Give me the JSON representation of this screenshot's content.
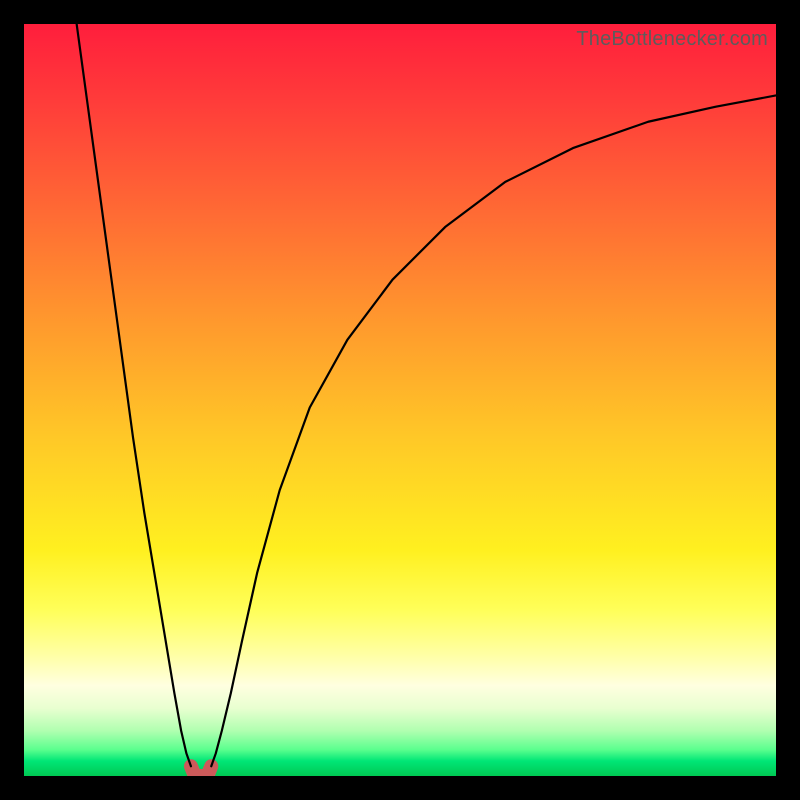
{
  "watermark": {
    "text": "TheBottlenecker.com"
  },
  "chart_data": {
    "type": "line",
    "title": "",
    "xlabel": "",
    "ylabel": "",
    "xlim": [
      0,
      100
    ],
    "ylim": [
      0,
      100
    ],
    "grid": false,
    "legend": false,
    "series": [
      {
        "name": "curve-left",
        "x": [
          7.0,
          8.5,
          10.0,
          11.5,
          13.0,
          14.5,
          16.0,
          17.5,
          19.0,
          20.0,
          20.9,
          21.6,
          22.2
        ],
        "y": [
          100,
          89,
          78,
          67,
          56,
          45,
          35,
          26,
          17,
          11,
          6,
          3,
          1.3
        ]
      },
      {
        "name": "curve-right",
        "x": [
          24.9,
          25.5,
          26.3,
          27.5,
          29.0,
          31.0,
          34.0,
          38.0,
          43.0,
          49.0,
          56.0,
          64.0,
          73.0,
          83.0,
          92.0,
          100.0
        ],
        "y": [
          1.3,
          3,
          6,
          11,
          18,
          27,
          38,
          49,
          58,
          66,
          73,
          79,
          83.5,
          87,
          89,
          90.5
        ]
      },
      {
        "name": "minimum-marker",
        "x": [
          22.2,
          22.6,
          23.2,
          24.0,
          24.5,
          24.9
        ],
        "y": [
          1.3,
          0.3,
          0.0,
          0.0,
          0.3,
          1.3
        ]
      }
    ],
    "annotations": []
  },
  "style": {
    "curve_color": "#000000",
    "curve_width": 2.2,
    "marker_color": "#cc5a5a",
    "marker_width": 14
  }
}
